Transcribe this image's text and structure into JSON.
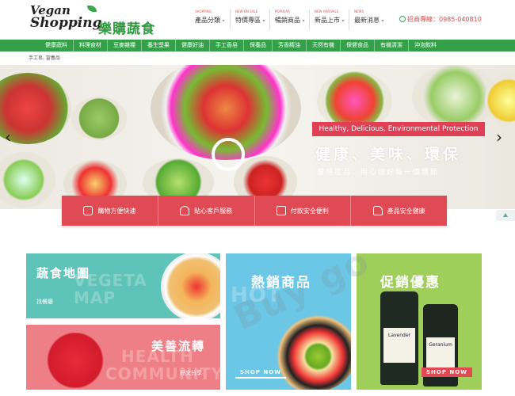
{
  "brand": {
    "logo_line1": "Vegan",
    "logo_line2": "Shopping",
    "logo_cn": "樂購蔬食"
  },
  "topnav": [
    {
      "en": "Shopping",
      "label": "產品分類"
    },
    {
      "en": "New on sale",
      "label": "特價專區"
    },
    {
      "en": "Popular",
      "label": "暢銷商品"
    },
    {
      "en": "New arrivals",
      "label": "新品上市"
    },
    {
      "en": "News",
      "label": "最新消息"
    }
  ],
  "contact": {
    "phone_label": "招商專線：0985-040810"
  },
  "categories": [
    "健康蔬料",
    "料理食材",
    "豆麥雜糧",
    "養生堅果",
    "健康好油",
    "手工香皂",
    "保養品",
    "芳香精油",
    "天然有機",
    "保健食品",
    "有機清潔",
    "沖泡飲料"
  ],
  "breadcrumb": "手工皂, 當養品",
  "hero": {
    "banner": "Healthy, Delicious, Environmental Protection",
    "title": "健康、美味、環保",
    "subtitle": "嚴格控品．用心做好每一個環節"
  },
  "services": [
    {
      "icon": "truck-icon",
      "label": "購物方便快速"
    },
    {
      "icon": "headset-icon",
      "label": "貼心客戶服務"
    },
    {
      "icon": "lock-icon",
      "label": "付款安全便利"
    },
    {
      "icon": "thumbs-up-icon",
      "label": "產品安全健康"
    }
  ],
  "tiles": {
    "map": {
      "title": "蔬食地圖",
      "sub": "找餐廳",
      "ghost1": "VEGETA",
      "ghost2": "MAP"
    },
    "community": {
      "title": "美善流轉",
      "sub": "好文分享",
      "ghost1": "HEALTH",
      "ghost2": "COMMUNITY"
    },
    "hot": {
      "title": "熱銷商品",
      "cta": "SHOP NOW",
      "ghost1": "HOT"
    },
    "promo": {
      "title": "促銷優惠",
      "cta": "SHOP NOW",
      "bottle1": "Lavender",
      "bottle2": "Geranium"
    }
  },
  "watermark": "Buy go",
  "colors": {
    "brand_green": "#35a04a",
    "accent_red": "#e04a55",
    "tile_teal": "#5ec3b8",
    "tile_salmon": "#ef7f86",
    "tile_sky": "#6cc6e6",
    "tile_lime": "#9fcf5a"
  }
}
